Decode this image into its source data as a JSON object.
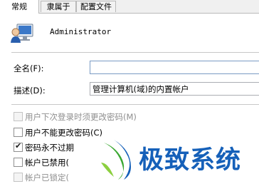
{
  "tabs": [
    "常规",
    "隶属于",
    "配置文件"
  ],
  "user": {
    "name": "Administrator"
  },
  "fields": {
    "fullname_label": "全名(F):",
    "fullname_value": "",
    "description_label": "描述(D):",
    "description_value": "管理计算机(域)的内置帐户"
  },
  "checkboxes": [
    {
      "label": "用户下次登录时须更改密码(M)",
      "checked": false,
      "disabled": true
    },
    {
      "label": "用户不能更改密码(C)",
      "checked": false,
      "disabled": false
    },
    {
      "label": "密码永不过期",
      "checked": true,
      "disabled": false
    },
    {
      "label": "帐户已禁用(",
      "checked": false,
      "disabled": false
    },
    {
      "label": "帐户已锁定(",
      "checked": false,
      "disabled": true
    }
  ],
  "watermark": {
    "text": "极致系统"
  },
  "colors": {
    "field_focus_border": "#7a9bc4",
    "watermark_blue": "#1560b9",
    "watermark_green": "#3aa832"
  }
}
